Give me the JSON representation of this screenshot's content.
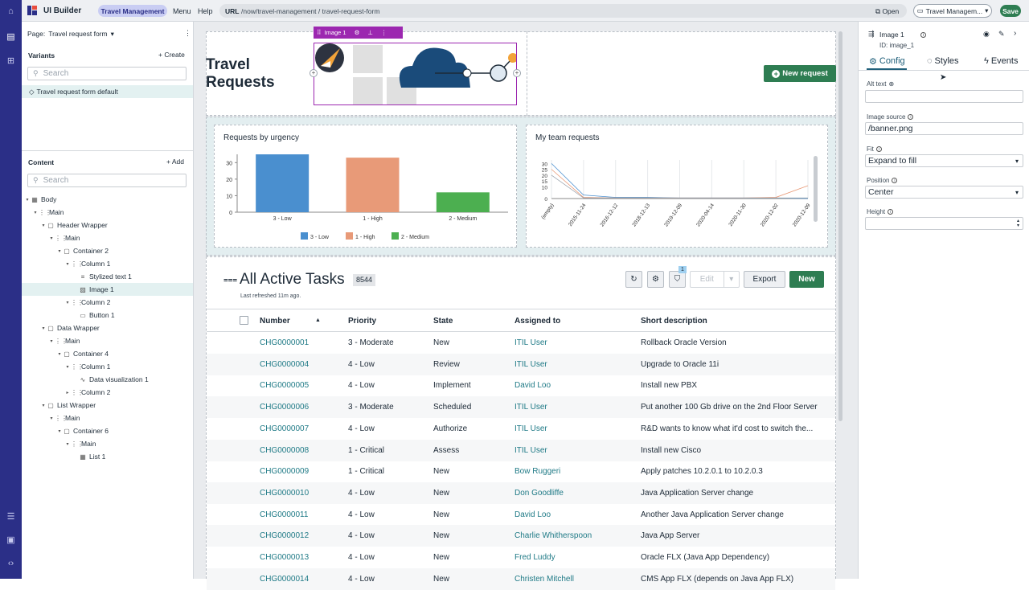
{
  "app": {
    "title": "UI Builder",
    "experience_tab": "Travel Management",
    "menu": "Menu",
    "help": "Help"
  },
  "url_bar": {
    "label": "URL",
    "value": "/now/travel-management / travel-request-form",
    "open": "Open"
  },
  "topbar_right": {
    "experience_select": "Travel Managem...",
    "save": "Save"
  },
  "colors": {
    "rail": "#2b2f87",
    "green": "#2e7d52",
    "selection": "#9c27b0",
    "link": "#1f7a86"
  },
  "left": {
    "page_label": "Page:",
    "page_value": "Travel request form",
    "variants_title": "Variants",
    "create": "+ Create",
    "search_placeholder": "Search",
    "variant_item": "Travel request form default",
    "content_title": "Content",
    "add": "+ Add",
    "tree": [
      {
        "label": "Body",
        "icon": "body-icon",
        "level": 0,
        "caret": "▾"
      },
      {
        "label": "Main",
        "icon": "grid-icon",
        "level": 1,
        "caret": "▾"
      },
      {
        "label": "Header Wrapper",
        "icon": "container-icon",
        "level": 2,
        "caret": "▾"
      },
      {
        "label": "Main",
        "icon": "grid-icon",
        "level": 3,
        "caret": "▾"
      },
      {
        "label": "Container 2",
        "icon": "container-icon",
        "level": 4,
        "caret": "▾"
      },
      {
        "label": "Column 1",
        "icon": "grid-icon",
        "level": 5,
        "caret": "▾"
      },
      {
        "label": "Stylized text 1",
        "icon": "text-icon",
        "level": 6,
        "caret": ""
      },
      {
        "label": "Image 1",
        "icon": "image-icon",
        "level": 6,
        "caret": "",
        "selected": true
      },
      {
        "label": "Column 2",
        "icon": "grid-icon",
        "level": 5,
        "caret": "▾"
      },
      {
        "label": "Button 1",
        "icon": "button-icon",
        "level": 6,
        "caret": ""
      },
      {
        "label": "Data Wrapper",
        "icon": "container-icon",
        "level": 2,
        "caret": "▾"
      },
      {
        "label": "Main",
        "icon": "grid-icon",
        "level": 3,
        "caret": "▾"
      },
      {
        "label": "Container 4",
        "icon": "container-icon",
        "level": 4,
        "caret": "▾"
      },
      {
        "label": "Column 1",
        "icon": "grid-icon",
        "level": 5,
        "caret": "▾"
      },
      {
        "label": "Data visualization 1",
        "icon": "chart-icon",
        "level": 6,
        "caret": ""
      },
      {
        "label": "Column 2",
        "icon": "grid-icon",
        "level": 5,
        "caret": "▸"
      },
      {
        "label": "List Wrapper",
        "icon": "container-icon",
        "level": 2,
        "caret": "▾"
      },
      {
        "label": "Main",
        "icon": "grid-icon",
        "level": 3,
        "caret": "▾"
      },
      {
        "label": "Container 6",
        "icon": "container-icon",
        "level": 4,
        "caret": "▾"
      },
      {
        "label": "Main",
        "icon": "grid-icon",
        "level": 5,
        "caret": "▾"
      },
      {
        "label": "List 1",
        "icon": "list-icon",
        "level": 6,
        "caret": ""
      }
    ]
  },
  "canvas": {
    "heading_line1": "Travel",
    "heading_line2": "Requests",
    "selection_label": "Image 1",
    "new_request": "New request",
    "urgency_title": "Requests by urgency",
    "team_title": "My team requests",
    "list_title": "All Active Tasks",
    "list_count": "8544",
    "refreshed": "Last refreshed 11m ago.",
    "filter_badge": "1",
    "edit": "Edit",
    "export": "Export",
    "new": "New",
    "columns": [
      "Number",
      "Priority",
      "State",
      "Assigned to",
      "Short description"
    ],
    "rows": [
      [
        "CHG0000001",
        "3 - Moderate",
        "New",
        "ITIL User",
        "Rollback Oracle Version"
      ],
      [
        "CHG0000004",
        "4 - Low",
        "Review",
        "ITIL User",
        "Upgrade to Oracle 11i"
      ],
      [
        "CHG0000005",
        "4 - Low",
        "Implement",
        "David Loo",
        "Install new PBX"
      ],
      [
        "CHG0000006",
        "3 - Moderate",
        "Scheduled",
        "ITIL User",
        "Put another 100 Gb drive on the 2nd Floor Server"
      ],
      [
        "CHG0000007",
        "4 - Low",
        "Authorize",
        "ITIL User",
        "R&D wants to know what it'd cost to switch the..."
      ],
      [
        "CHG0000008",
        "1 - Critical",
        "Assess",
        "ITIL User",
        "Install new Cisco"
      ],
      [
        "CHG0000009",
        "1 - Critical",
        "New",
        "Bow Ruggeri",
        "Apply patches 10.2.0.1 to 10.2.0.3"
      ],
      [
        "CHG0000010",
        "4 - Low",
        "New",
        "Don Goodliffe",
        "Java Application Server change"
      ],
      [
        "CHG0000011",
        "4 - Low",
        "New",
        "David Loo",
        "Another Java Application Server change"
      ],
      [
        "CHG0000012",
        "4 - Low",
        "New",
        "Charlie Whitherspoon",
        "Java App Server"
      ],
      [
        "CHG0000013",
        "4 - Low",
        "New",
        "Fred Luddy",
        "Oracle FLX (Java App Dependency)"
      ],
      [
        "CHG0000014",
        "4 - Low",
        "New",
        "Christen Mitchell",
        "CMS App FLX (depends on Java App FLX)"
      ]
    ]
  },
  "chart_data": [
    {
      "type": "bar",
      "title": "Requests by urgency",
      "categories": [
        "3 - Low",
        "1 - High",
        "2 - Medium"
      ],
      "values": [
        35,
        33,
        12
      ],
      "colors": [
        "#4a8fcf",
        "#e89a78",
        "#4caf50"
      ],
      "ylim": [
        0,
        35
      ],
      "yticks": [
        0,
        10,
        20,
        30
      ],
      "legend": [
        "3 - Low",
        "1 - High",
        "2 - Medium"
      ],
      "legend_position": "bottom"
    },
    {
      "type": "line",
      "title": "My team requests",
      "categories": [
        "(empty)",
        "2015-11-24",
        "2016-12-12",
        "2018-12-13",
        "2019-12-09",
        "2020-04-14",
        "2020-11-30",
        "2020-12-02",
        "2020-12-09"
      ],
      "series": [
        {
          "color": "#4a8fcf",
          "values": [
            30,
            3,
            1,
            1,
            0.5,
            0.5,
            0.5,
            0.5,
            0
          ]
        },
        {
          "color": "#e89a78",
          "values": [
            25,
            1,
            0.5,
            0.5,
            0.5,
            0.5,
            0.5,
            1,
            11
          ]
        },
        {
          "color": "#9aa3ad",
          "values": [
            20,
            0.5,
            0.5,
            0.5,
            0.5,
            0.5,
            0.5,
            0.5,
            0.5
          ]
        }
      ],
      "ylim": [
        0,
        33
      ],
      "yticks": [
        0,
        10,
        15,
        20,
        25,
        30
      ]
    }
  ],
  "right": {
    "component": "Image 1",
    "id": "ID: image_1",
    "tabs": [
      "Config",
      "Styles",
      "Events"
    ],
    "alt_text_label": "Alt text",
    "alt_text_value": "",
    "image_source_label": "Image source",
    "image_source_value": "/banner.png",
    "fit_label": "Fit",
    "fit_value": "Expand to fill",
    "position_label": "Position",
    "position_value": "Center",
    "height_label": "Height",
    "height_value": ""
  }
}
